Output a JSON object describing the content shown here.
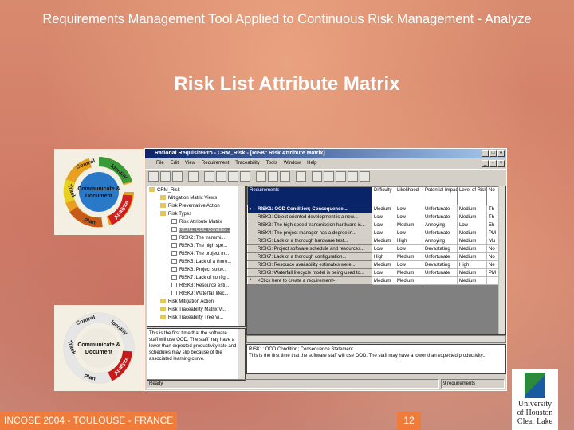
{
  "slide": {
    "title": "Requirements Management Tool Applied to Continuous Risk Management - Analyze",
    "subtitle": "Risk List Attribute Matrix",
    "footer": "INCOSE 2004 - TOULOUSE - FRANCE",
    "page": "12",
    "logo": [
      "University",
      "of Houston",
      "Clear Lake"
    ],
    "cycle": {
      "center": "Communicate & Document",
      "steps": [
        "Control",
        "Identify",
        "Analyze",
        "Plan",
        "Track"
      ]
    }
  },
  "window": {
    "title": "Rational RequisitePro - CRM_Risk - [RISK: Risk Attribute Matrix]",
    "menu": [
      "File",
      "Edit",
      "View",
      "Requirement",
      "Traceability",
      "Tools",
      "Window",
      "Help"
    ],
    "tree": [
      {
        "t": "CRM_Risk",
        "k": "root"
      },
      {
        "t": "Mitigation Matrix Views",
        "k": "fold"
      },
      {
        "t": "Risk Preventative Action",
        "k": "fold"
      },
      {
        "t": "Risk Types",
        "k": "fold"
      },
      {
        "t": "Risk Attribute Matrix",
        "k": "doc"
      },
      {
        "t": "RISK1: OOD Conditio...",
        "k": "sel"
      },
      {
        "t": "RISK2: The transmi...",
        "k": "doc"
      },
      {
        "t": "RISK3: The high spe...",
        "k": "doc"
      },
      {
        "t": "RISK4: The project m...",
        "k": "doc"
      },
      {
        "t": "RISK5: Lack of a thoro...",
        "k": "doc"
      },
      {
        "t": "RISK6: Project softw...",
        "k": "doc"
      },
      {
        "t": "RISK7: Lack of config...",
        "k": "doc"
      },
      {
        "t": "RISK8: Resource esti...",
        "k": "doc"
      },
      {
        "t": "RISK9: Waterfall lifec...",
        "k": "doc"
      },
      {
        "t": "Risk Mitigation Action",
        "k": "fold"
      },
      {
        "t": "Risk Traceability Matrix Vi...",
        "k": "fold"
      },
      {
        "t": "Risk Traceability Tree Vi...",
        "k": "fold"
      }
    ],
    "description": "This is the first time that the software staff will use OOD. The staff may have a lower than expected productivity rate and schedules may slip because of the associated learning curve.",
    "columns": [
      "Requirements",
      "Difficulty",
      "Likelihood",
      "Potential Impact",
      "Level of Risk",
      "No"
    ],
    "rows": [
      [
        "▸",
        "RISK1: OOD Condition; Consequence...",
        "Medium",
        "Low",
        "Unfortunate",
        "Medium",
        "Th"
      ],
      [
        "",
        "RISK2: Object oriented development is a new...",
        "Low",
        "Low",
        "Unfortunate",
        "Medium",
        "Th"
      ],
      [
        "",
        "RISK3: The high speed transmission hardware is...",
        "Low",
        "Medium",
        "Annoying",
        "Low",
        "Eh"
      ],
      [
        "",
        "RISK4: The project manager has a degree in...",
        "Low",
        "Low",
        "Unfortunate",
        "Medium",
        "PM"
      ],
      [
        "",
        "RISK5: Lack of a thorough hardware test...",
        "Medium",
        "High",
        "Annoying",
        "Medium",
        "Mu"
      ],
      [
        "",
        "RISK6: Project software schedule and resources...",
        "Low",
        "Low",
        "Devastating",
        "Medium",
        "No"
      ],
      [
        "",
        "RISK7: Lack of a thorough configuration...",
        "High",
        "Medium",
        "Unfortunate",
        "Medium",
        "No"
      ],
      [
        "",
        "RISK8: Resource availability estimates were...",
        "Medium",
        "Low",
        "Devastating",
        "High",
        "Ne"
      ],
      [
        "",
        "RISK9: Waterfall lifecycle model is being used to...",
        "Low",
        "Medium",
        "Unfortunate",
        "Medium",
        "PM"
      ],
      [
        "*",
        "<Click here to create a requirement>",
        "Medium",
        "Medium",
        "",
        "Medium",
        ""
      ]
    ],
    "detail_title": "RISK1: OOD Condition; Consequence Statement",
    "detail_text": "This is the first time that the software staff will use OOD. The staff may have a lower than expected productivity...",
    "status_left": "Ready",
    "status_right": "9 requirements"
  }
}
